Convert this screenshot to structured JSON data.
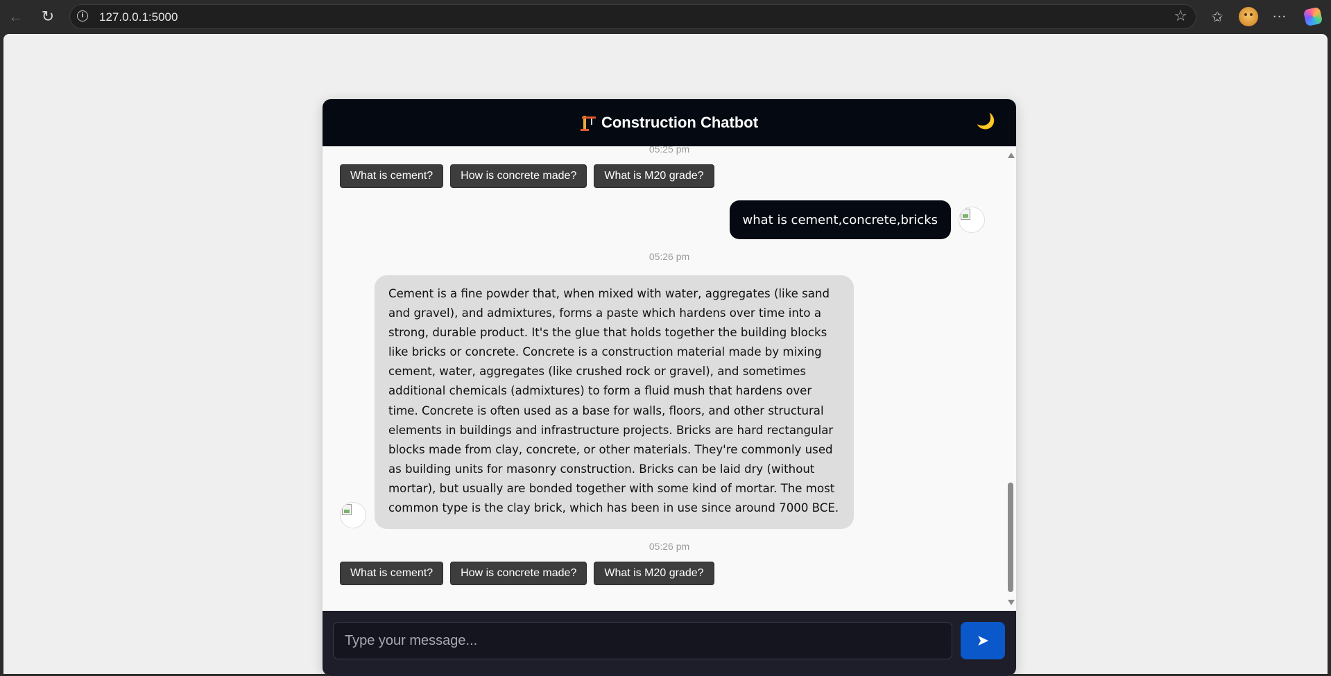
{
  "browser": {
    "url": "127.0.0.1:5000",
    "back_glyph": "←",
    "reload_glyph": "↻",
    "info_glyph": "i",
    "star_glyph": "☆",
    "favorites_glyph": "✩",
    "menu_glyph": "···"
  },
  "header": {
    "title": "Construction Chatbot",
    "theme_toggle_glyph": "🌙"
  },
  "messages": {
    "timestamp_1": "05:25 pm",
    "quick_replies_1": [
      "What is cement?",
      "How is concrete made?",
      "What is M20 grade?"
    ],
    "user_message": "what is cement,concrete,bricks",
    "timestamp_2": "05:26 pm",
    "bot_message": "Cement is a fine powder that, when mixed with water, aggregates (like sand and gravel), and admixtures, forms a paste which hardens over time into a strong, durable product. It's the glue that holds together the building blocks like bricks or concrete. Concrete is a construction material made by mixing cement, water, aggregates (like crushed rock or gravel), and sometimes additional chemicals (admixtures) to form a fluid mush that hardens over time. Concrete is often used as a base for walls, floors, and other structural elements in buildings and infrastructure projects. Bricks are hard rectangular blocks made from clay, concrete, or other materials. They're commonly used as building units for masonry construction. Bricks can be laid dry (without mortar), but usually are bonded together with some kind of mortar. The most common type is the clay brick, which has been in use since around 7000 BCE.",
    "timestamp_3": "05:26 pm",
    "quick_replies_2": [
      "What is cement?",
      "How is concrete made?",
      "What is M20 grade?"
    ]
  },
  "input": {
    "placeholder": "Type your message...",
    "value": "",
    "send_glyph": "➤"
  },
  "colors": {
    "header_bg": "#050a12",
    "user_bubble": "#050a12",
    "bot_bubble": "#dddddd",
    "quick_reply_bg": "#3d3d3d",
    "send_button": "#0a58c9",
    "input_area_bg": "#1e1e2a"
  },
  "icons": {
    "header": "crane-icon",
    "theme_toggle": "moon-icon",
    "send": "send-arrow-icon",
    "avatars": "broken-image-icon"
  }
}
